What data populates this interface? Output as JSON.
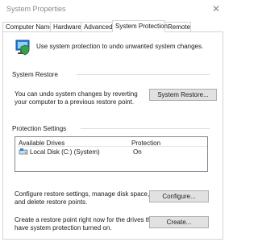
{
  "window": {
    "title": "System Properties"
  },
  "tabs": [
    {
      "label": "Computer Name"
    },
    {
      "label": "Hardware"
    },
    {
      "label": "Advanced"
    },
    {
      "label": "System Protection"
    },
    {
      "label": "Remote"
    }
  ],
  "intro": {
    "text": "Use system protection to undo unwanted system changes."
  },
  "restore": {
    "heading": "System Restore",
    "line1": "You can undo system changes by reverting",
    "line2": "your computer to a previous restore point.",
    "button": "System Restore..."
  },
  "protection": {
    "heading": "Protection Settings",
    "columns": [
      "Available Drives",
      "Protection"
    ],
    "rows": [
      {
        "drive": "Local Disk (C:) (System)",
        "status": "On"
      }
    ],
    "configure_line1": "Configure restore settings, manage disk space,",
    "configure_line2": "and delete restore points.",
    "configure_button": "Configure...",
    "create_line1": "Create a restore point right now for the drives that",
    "create_line2": "have system protection turned on.",
    "create_button": "Create..."
  }
}
